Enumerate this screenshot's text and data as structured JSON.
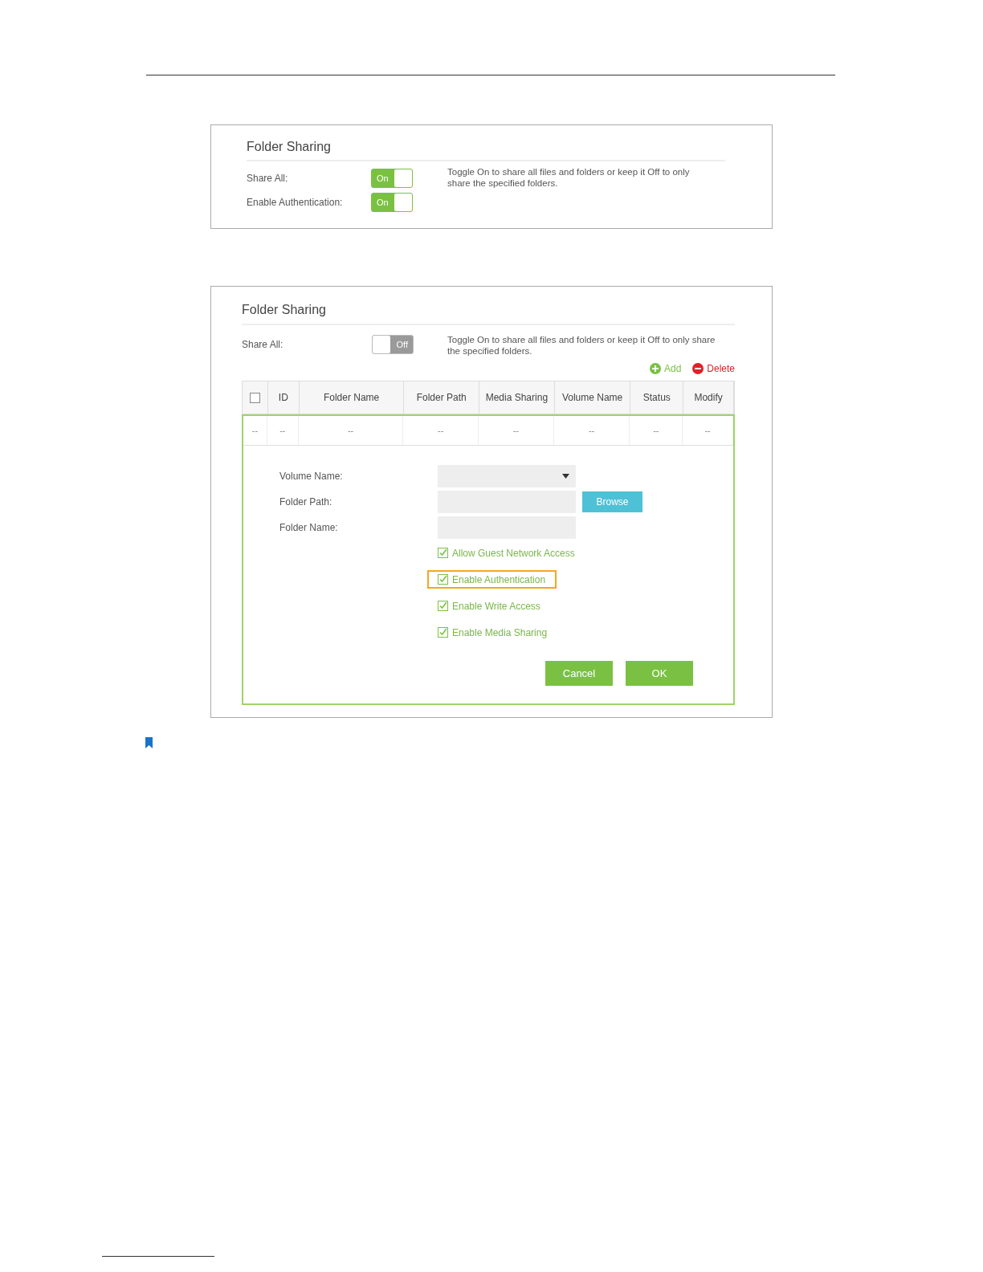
{
  "panel_1": {
    "title": "Folder Sharing",
    "rows": [
      {
        "label": "Share All:",
        "toggle": {
          "label": "On",
          "on": true
        }
      },
      {
        "label": "Enable Authentication:",
        "toggle": {
          "label": "On",
          "on": true
        }
      }
    ],
    "description": "Toggle On to share all files and folders or keep it Off to only share the specified folders."
  },
  "panel_2": {
    "title": "Folder Sharing",
    "share_all": {
      "label": "Share All:",
      "toggle": {
        "label": "Off",
        "on": false
      }
    },
    "description": "Toggle On to share all files and folders or keep it Off to only share the specified folders.",
    "actions": [
      {
        "kind": "add",
        "label": "Add"
      },
      {
        "kind": "delete",
        "label": "Delete"
      }
    ],
    "table": {
      "columns": [
        {
          "kind": "checkbox",
          "checked": false
        },
        {
          "kind": "text",
          "label": "ID"
        },
        {
          "kind": "text",
          "label": "Folder Name"
        },
        {
          "kind": "text",
          "label": "Folder Path"
        },
        {
          "kind": "text",
          "label": "Media Sharing"
        },
        {
          "kind": "text",
          "label": "Volume Name"
        },
        {
          "kind": "text",
          "label": "Status"
        },
        {
          "kind": "text",
          "label": "Modify"
        }
      ],
      "rows": [
        {
          "cells": [
            "--",
            "--",
            "--",
            "--",
            "--",
            "--",
            "--",
            "--"
          ]
        }
      ]
    },
    "form": {
      "fields": [
        {
          "kind": "select",
          "label": "Volume Name:"
        },
        {
          "kind": "text",
          "label": "Folder Path:",
          "button": "Browse"
        },
        {
          "kind": "text",
          "label": "Folder Name:"
        }
      ],
      "options": [
        {
          "label": "Allow Guest Network Access",
          "checked": true,
          "highlighted": false
        },
        {
          "label": "Enable Authentication",
          "checked": true,
          "highlighted": true
        },
        {
          "label": "Enable Write Access",
          "checked": true,
          "highlighted": false
        },
        {
          "label": "Enable Media Sharing",
          "checked": true,
          "highlighted": false
        }
      ],
      "buttons": [
        "Cancel",
        "OK"
      ]
    }
  }
}
